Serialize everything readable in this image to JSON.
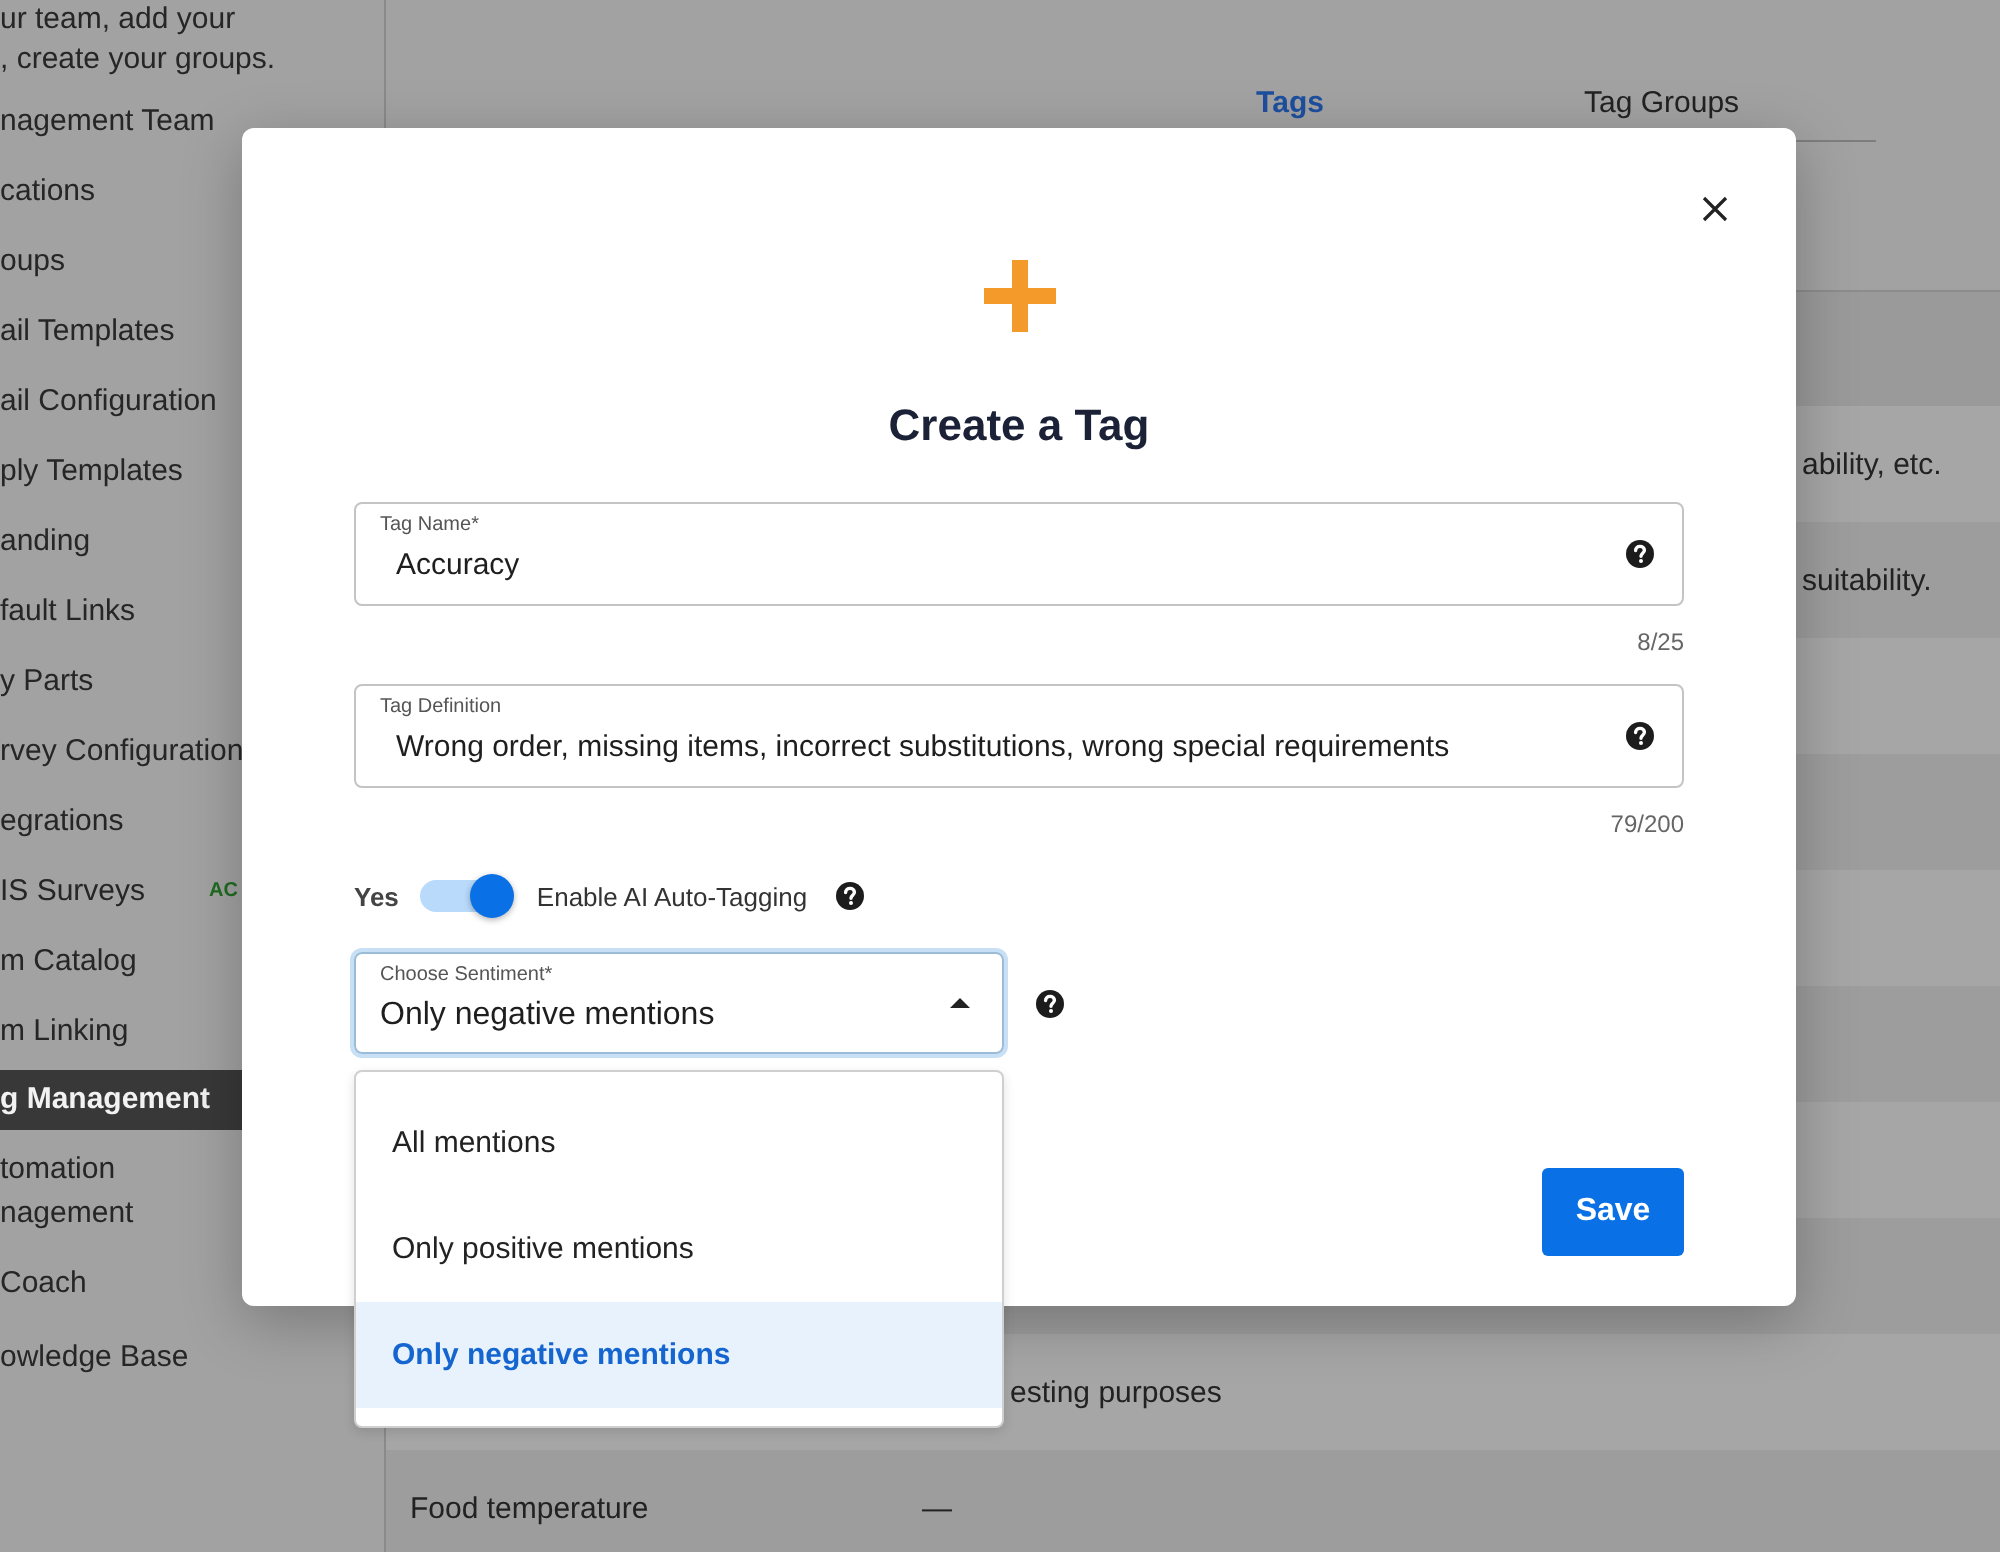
{
  "sidebar": {
    "intro": [
      "ur team, add your",
      ", create your groups."
    ],
    "items": [
      {
        "label": "nagement Team",
        "selected": false
      },
      {
        "label": "cations",
        "selected": false
      },
      {
        "label": "oups",
        "selected": false
      },
      {
        "label": "ail Templates",
        "selected": false
      },
      {
        "label": "ail Configuration",
        "selected": false
      },
      {
        "label": "ply Templates",
        "selected": false
      },
      {
        "label": "anding",
        "selected": false
      },
      {
        "label": "fault Links",
        "selected": false
      },
      {
        "label": "y Parts",
        "selected": false
      },
      {
        "label": "rvey Configuration",
        "selected": false
      },
      {
        "label": "egrations",
        "selected": false
      },
      {
        "label": "IS Surveys",
        "selected": false,
        "badge": "AC"
      },
      {
        "label": "m Catalog",
        "selected": false
      },
      {
        "label": "m Linking",
        "selected": false
      },
      {
        "label": "g Management",
        "selected": true
      },
      {
        "label": "tomation\nnagement",
        "selected": false
      },
      {
        "label": "Coach",
        "selected": false
      },
      {
        "label": "owledge Base",
        "selected": false
      }
    ]
  },
  "tabs": [
    {
      "label": "Tags",
      "selected": true
    },
    {
      "label": "Tag Groups",
      "selected": false
    }
  ],
  "table": {
    "rows": [
      {
        "column_4": "ability, etc."
      },
      {
        "column_4": "suitability."
      },
      {},
      {},
      {},
      {},
      {},
      {},
      {
        "column_3": "esting purposes"
      },
      {
        "column_1": "Food temperature",
        "column_2": "—"
      }
    ]
  },
  "dialog": {
    "title": "Create a Tag",
    "fields": [
      {
        "label": "Tag Name*",
        "value": "Accuracy",
        "counter": "8/25"
      },
      {
        "label": "Tag Definition",
        "value": "Wrong order, missing items, incorrect substitutions, wrong special requirements",
        "counter": "79/200"
      }
    ],
    "toggle": {
      "state_label": "Yes",
      "label": "Enable AI Auto-Tagging",
      "on": true
    },
    "select": {
      "label": "Choose Sentiment*",
      "value": "Only negative mentions",
      "expanded": true,
      "options": [
        {
          "label": "All mentions",
          "selected": false
        },
        {
          "label": "Only positive mentions",
          "selected": false
        },
        {
          "label": "Only negative mentions",
          "selected": true
        }
      ]
    },
    "save_button": "Save"
  }
}
